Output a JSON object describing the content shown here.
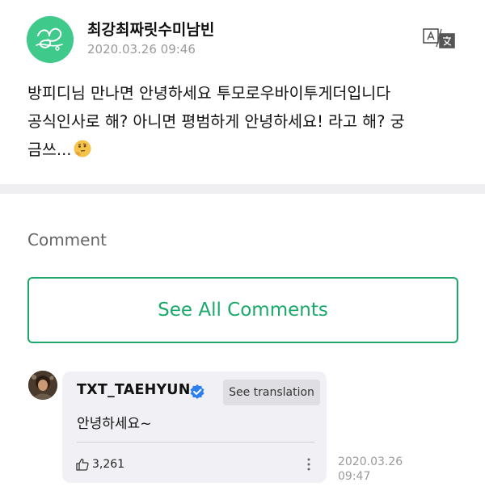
{
  "post": {
    "author": "최강최짜릿수미남빈",
    "date": "2020.03.26 09:46",
    "body_line1": "방피디님 만나면 안녕하세요 투모로우바이투게더입니다",
    "body_line2": "공식인사로 해? 아니면 평범하게 안녕하세요! 라고 해? 궁",
    "body_line3": "금쓰...",
    "emoji": "thinking-face"
  },
  "comments_section": {
    "title": "Comment",
    "see_all_label": "See All Comments"
  },
  "comment": {
    "author": "TXT_TAEHYUN",
    "verified": true,
    "translate_label": "See translation",
    "text": "안녕하세요~",
    "likes": "3,261",
    "date_line1": "2020.03.26",
    "date_line2": "09:47"
  },
  "colors": {
    "accent": "#1aa96b",
    "avatar_green": "#3fc98a",
    "verified_blue": "#2d7ff0"
  }
}
